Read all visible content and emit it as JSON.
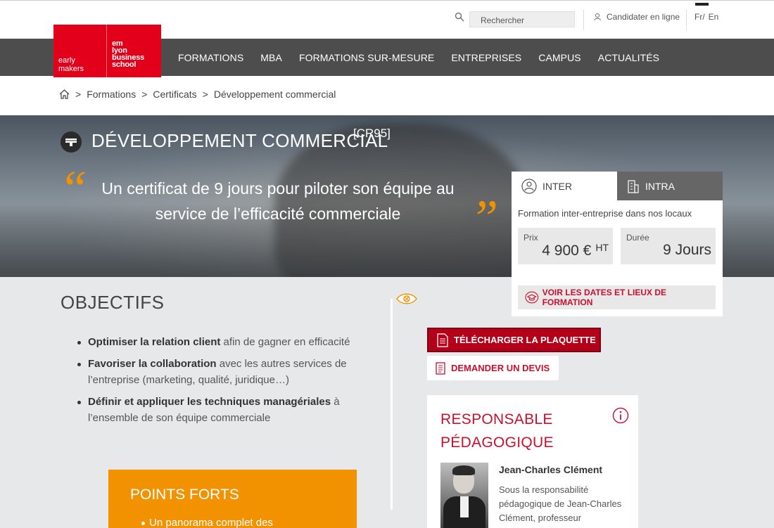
{
  "topbar": {
    "search_placeholder": "Rechercher",
    "candidater": "Candidater en ligne",
    "lang_fr": "Fr/",
    "lang_en": "En"
  },
  "logo": {
    "left_line1": "early",
    "left_line2": "makers",
    "right_line1": "em",
    "right_line2": "lyon",
    "right_line3": "business",
    "right_line4": "school"
  },
  "nav": [
    "FORMATIONS",
    "MBA",
    "FORMATIONS SUR-MESURE",
    "ENTREPRISES",
    "CAMPUS",
    "ACTUALITÉS"
  ],
  "breadcrumb": {
    "sep": ">",
    "items": [
      "Formations",
      "Certificats",
      "Développement commercial"
    ]
  },
  "hero": {
    "title": "DÉVELOPPEMENT COMMERCIAL",
    "code": "[CR95]",
    "quote_open": "“",
    "quote_close": "”",
    "quote": "Un certificat de 9 jours pour piloter son équipe au service de l’efficacité commerciale"
  },
  "card": {
    "tab_inter": "INTER",
    "tab_intra": "INTRA",
    "description": "Formation inter-entreprise dans nos locaux",
    "prix_label": "Prix",
    "prix_value": "4 900 €",
    "prix_suffix": "HT",
    "duree_label": "Durée",
    "duree_value": "9 Jours",
    "dates_button": "VOIR LES DATES ET LIEUX DE FORMATION"
  },
  "objectifs": {
    "title": "OBJECTIFS",
    "items": [
      {
        "bold": "Optimiser la relation client",
        "rest": " afin de gagner en efficacité"
      },
      {
        "bold": "Favoriser la collaboration",
        "rest": " avec les autres services de l’entreprise (marketing, qualité, juridique…)"
      },
      {
        "bold": "Définir et appliquer les techniques managériales",
        "rest": " à l’ensemble de son équipe commerciale"
      }
    ]
  },
  "points_forts": {
    "title": "POINTS FORTS",
    "first_item": "Un panorama complet des"
  },
  "actions": {
    "download": "TÉLÉCHARGER LA PLAQUETTE",
    "devis": "DEMANDER UN DEVIS"
  },
  "responsable": {
    "title": "RESPONSABLE PÉDAGOGIQUE",
    "name": "Jean-Charles Clément",
    "text": "Sous la responsabilité pédagogique de Jean-Charles Clément, professeur"
  },
  "colors": {
    "brand_red": "#e2001a",
    "accent_orange": "#f39200",
    "nav_gray": "#4d4d4d"
  }
}
